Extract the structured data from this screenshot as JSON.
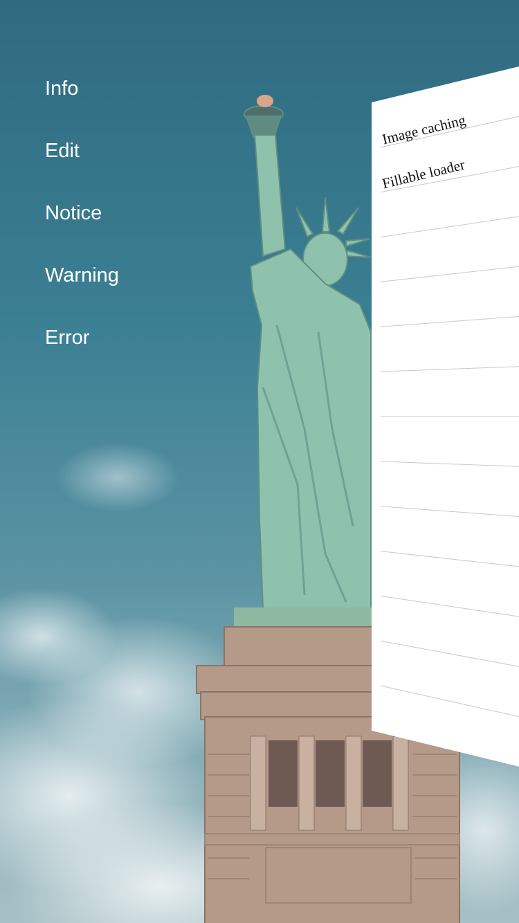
{
  "menu": {
    "items": [
      {
        "label": "Info"
      },
      {
        "label": "Edit"
      },
      {
        "label": "Notice"
      },
      {
        "label": "Warning"
      },
      {
        "label": "Error"
      }
    ]
  },
  "panel": {
    "rows": [
      {
        "label": "Image caching"
      },
      {
        "label": "Fillable loader"
      },
      {
        "label": ""
      },
      {
        "label": ""
      },
      {
        "label": ""
      },
      {
        "label": ""
      },
      {
        "label": ""
      },
      {
        "label": ""
      },
      {
        "label": ""
      },
      {
        "label": ""
      },
      {
        "label": ""
      },
      {
        "label": ""
      },
      {
        "label": ""
      }
    ]
  },
  "colors": {
    "sky": "#3b7f93",
    "statue": "#8fc2ad",
    "stone": "#b59a8a",
    "menu_text": "#ffffff",
    "panel_bg": "#ffffff"
  }
}
